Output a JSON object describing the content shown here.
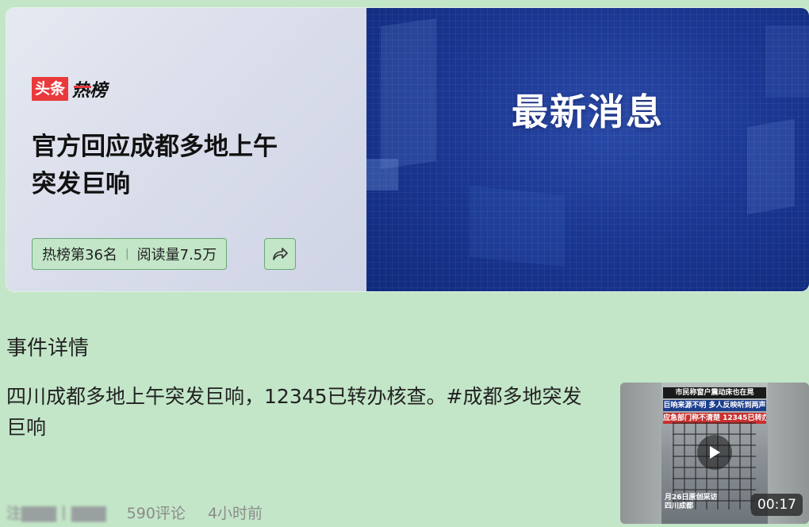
{
  "hero": {
    "logo_red": "头条",
    "logo_black": "热榜",
    "headline": "官方回应成都多地上午突发巨响",
    "rank": "热榜第36名",
    "reads": "阅读量7.5万",
    "banner_text": "最新消息",
    "share_icon": "share-icon"
  },
  "section": {
    "title": "事件详情"
  },
  "post": {
    "text": "四川成都多地上午突发巨响，12345已转办核查。#成都多地突发巨响",
    "author_blurred": "注▇▇▇丨▇▇▇",
    "comments": "590评论",
    "time": "4小时前"
  },
  "video": {
    "banner1": "市民称窗户震动床也在晃",
    "banner2": "巨响来源不明 多人反映听到两声",
    "banner3": "应急部门称不清楚 12345已转办核查",
    "caption_line1": "月26日原创采访",
    "caption_line2": "四川成都",
    "duration": "00:17",
    "play_icon": "play-icon"
  },
  "colors": {
    "page_bg": "#c3e6c8",
    "brand_red": "#e9393c",
    "banner_blue": "#1a3792"
  }
}
